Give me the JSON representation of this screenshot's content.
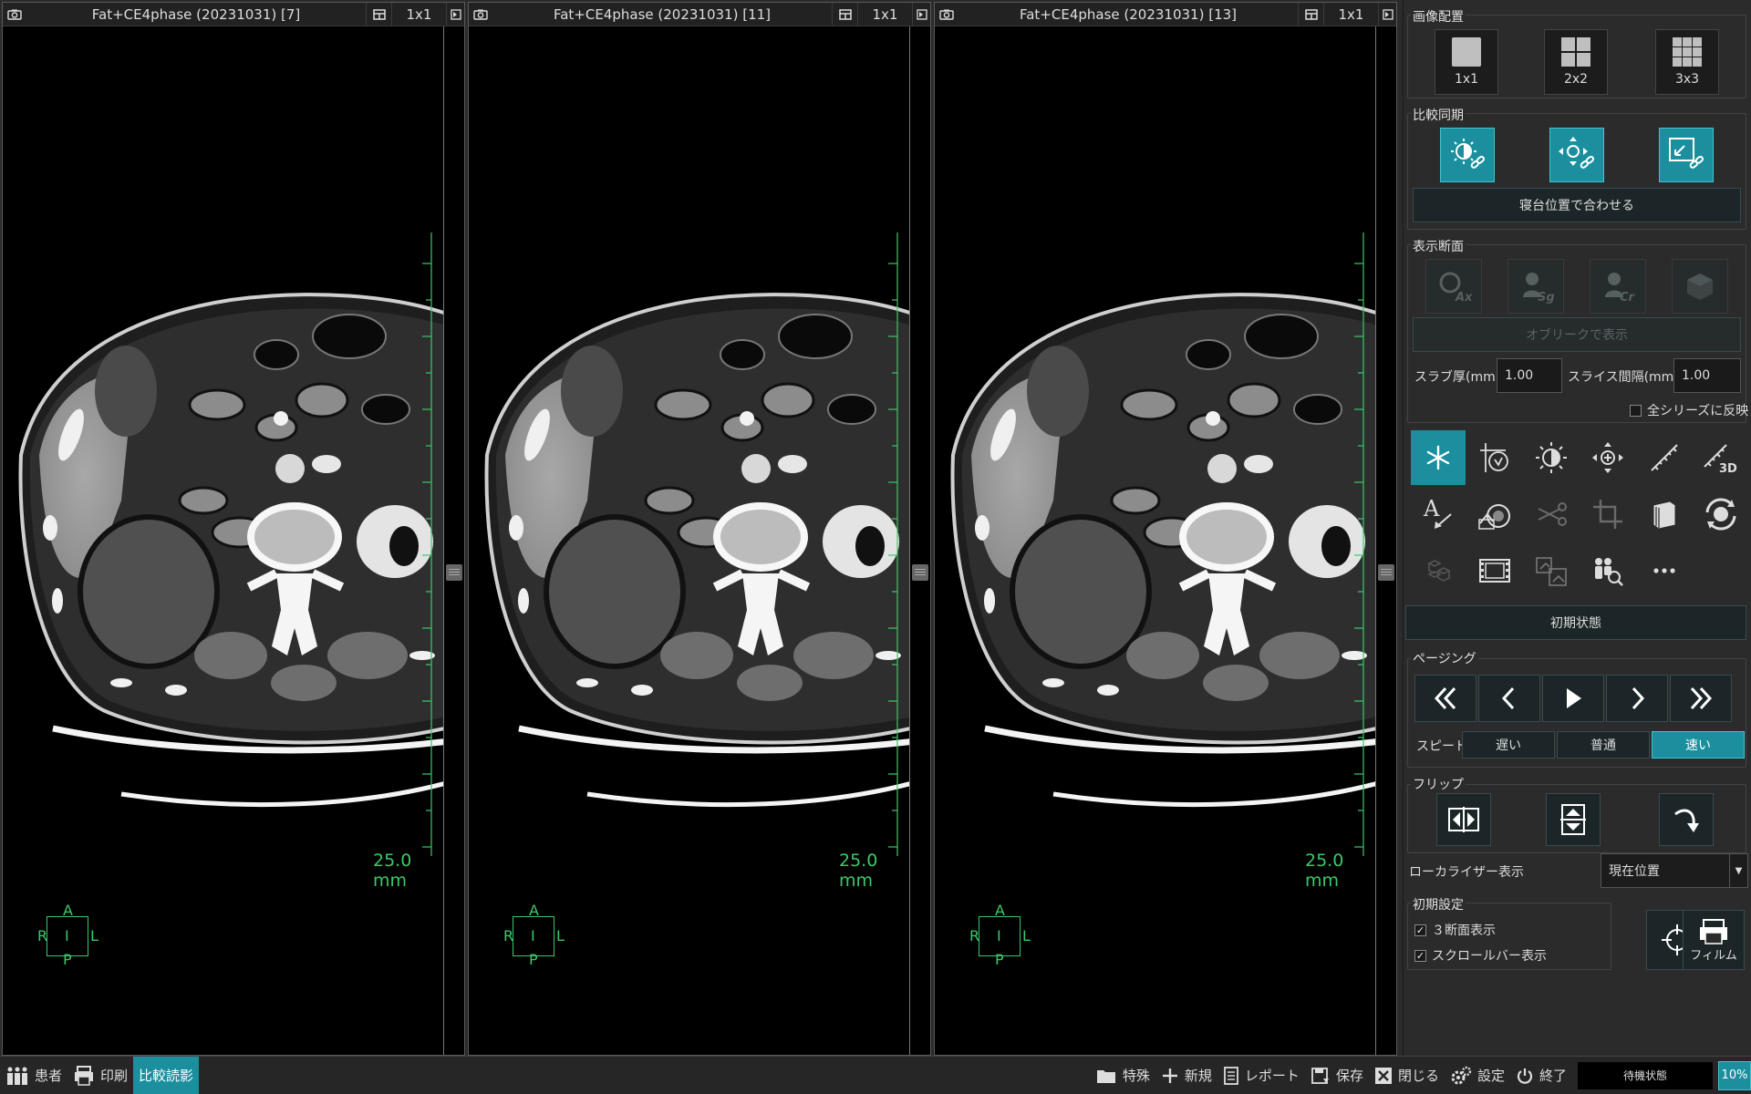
{
  "viewports": [
    {
      "title": "Fat+CE4phase (20231031) [7]",
      "layout": "1x1",
      "scale": "25.0 mm",
      "orientation": {
        "a": "A",
        "r": "R",
        "i": "I",
        "l": "L",
        "p": "P"
      }
    },
    {
      "title": "Fat+CE4phase (20231031) [11]",
      "layout": "1x1",
      "scale": "25.0 mm",
      "orientation": {
        "a": "A",
        "r": "R",
        "i": "I",
        "l": "L",
        "p": "P"
      }
    },
    {
      "title": "Fat+CE4phase (20231031) [13]",
      "layout": "1x1",
      "scale": "25.0 mm",
      "orientation": {
        "a": "A",
        "r": "R",
        "i": "I",
        "l": "L",
        "p": "P"
      }
    }
  ],
  "panel": {
    "image_layout": {
      "label": "画像配置",
      "options": [
        "1x1",
        "2x2",
        "3x3"
      ]
    },
    "compare_sync": {
      "label": "比較同期",
      "align_button": "寝台位置で合わせる"
    },
    "display_section": {
      "label": "表示断面",
      "oblique_button": "オブリークで表示",
      "slab_label": "スラブ厚(mm)",
      "slab_value": "1.00",
      "interval_label": "スライス間隔(mm)",
      "interval_value": "1.00",
      "apply_all": "全シリーズに反映"
    },
    "reset_button": "初期状態",
    "paging": {
      "label": "ページング",
      "speed_label": "スピード",
      "speeds": [
        "遅い",
        "普通",
        "速い"
      ],
      "active_speed": 2
    },
    "flip": {
      "label": "フリップ"
    },
    "localizer": {
      "label": "ローカライザー表示",
      "value": "現在位置"
    },
    "initial": {
      "label": "初期設定",
      "opt1": "３断面表示",
      "opt2": "スクロールバー表示",
      "film": "フィルム"
    }
  },
  "bottom": {
    "patient": "患者",
    "print": "印刷",
    "compare": "比較読影",
    "special": "特殊",
    "new": "新規",
    "report": "レポート",
    "save": "保存",
    "close": "閉じる",
    "settings": "設定",
    "exit": "終了",
    "status": "待機状態",
    "percent": "10%"
  },
  "colors": {
    "accent": "#1b8f9e",
    "overlay_green": "#3bc96a",
    "panel_bg": "#2b2b2b"
  }
}
